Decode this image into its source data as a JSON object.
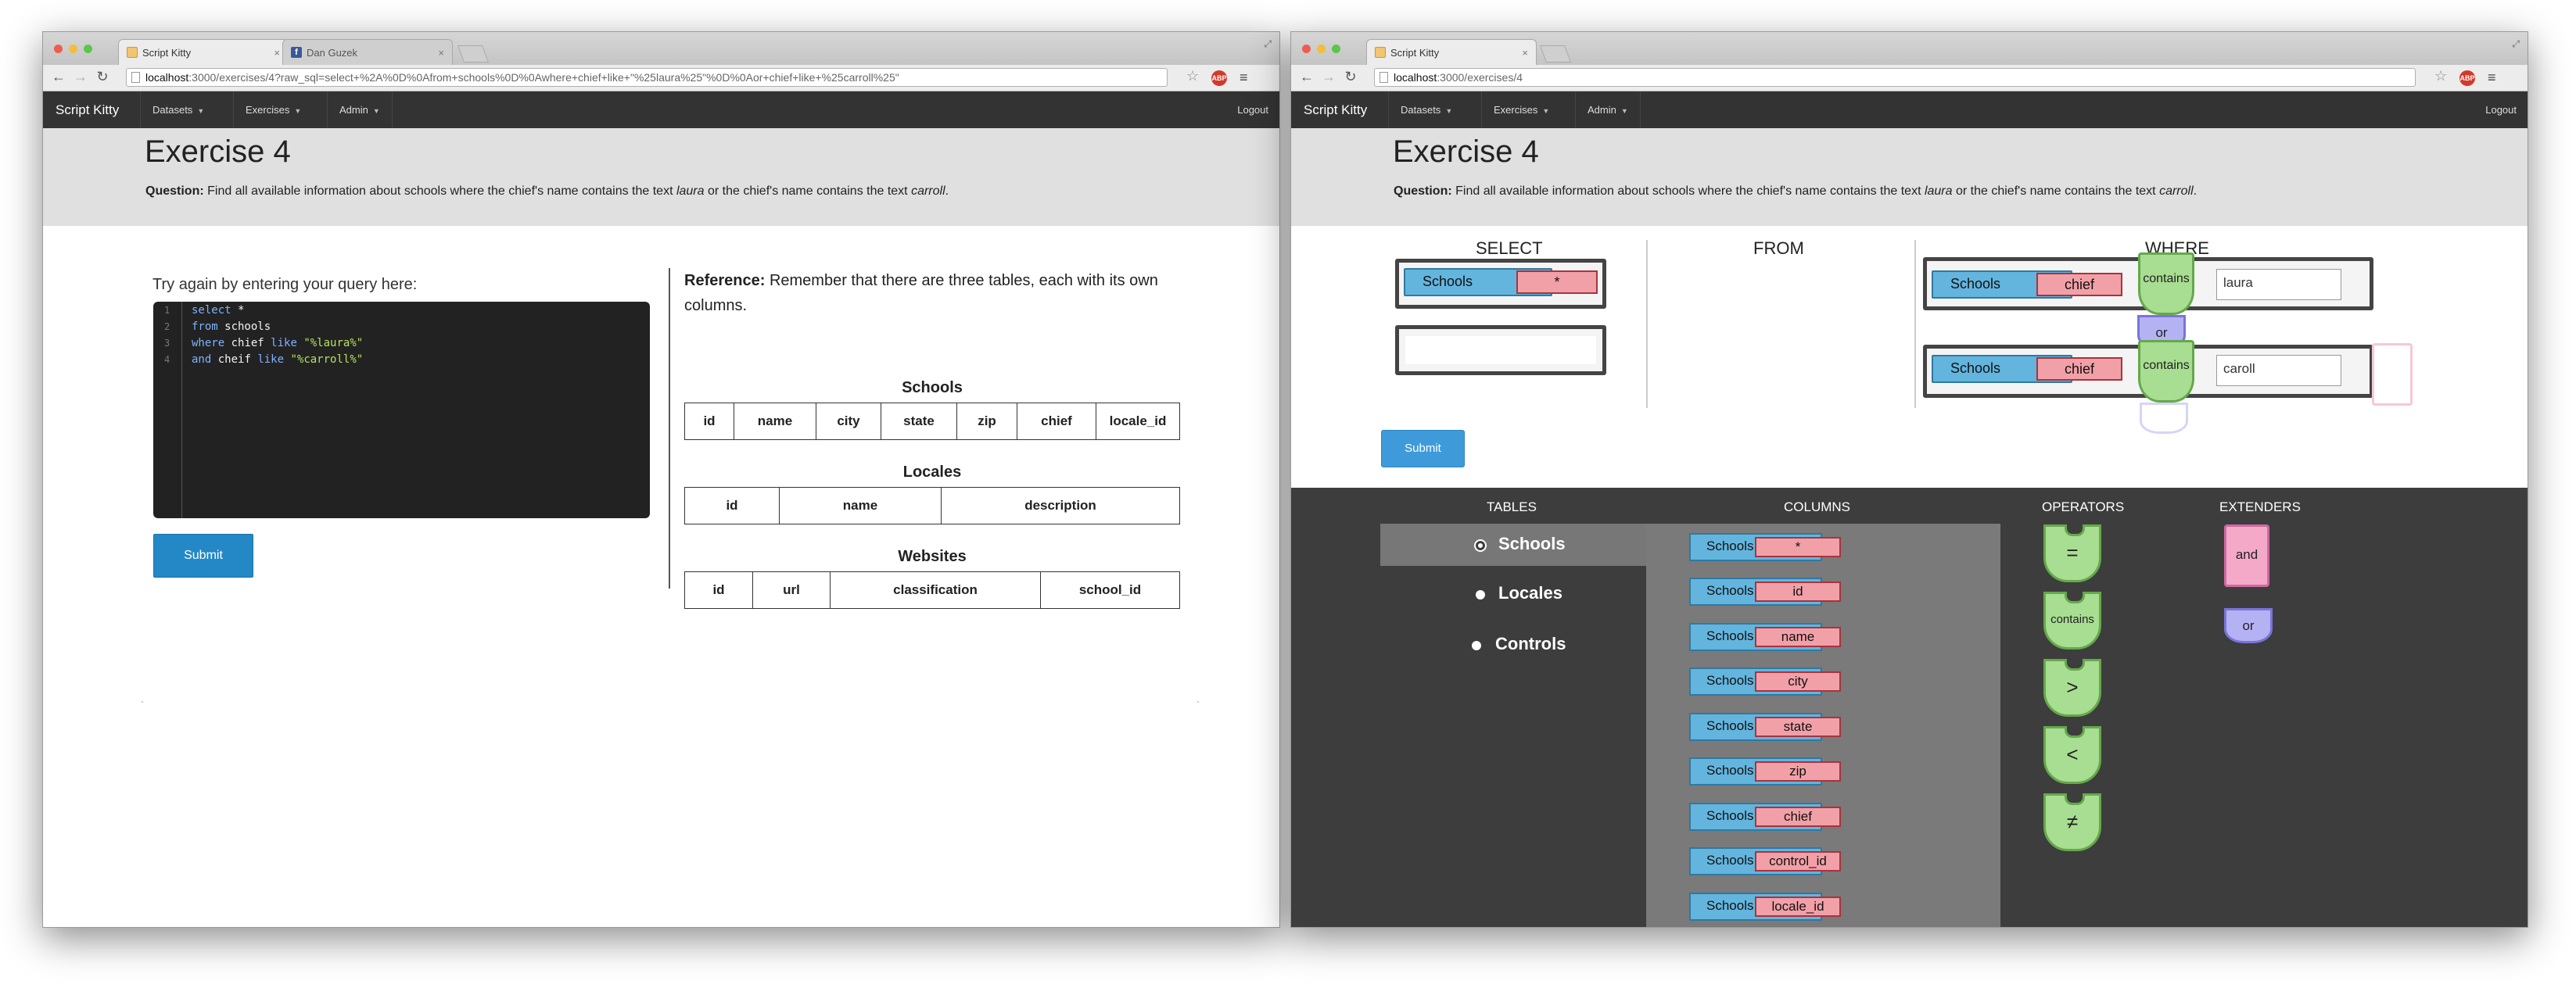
{
  "left": {
    "tabs": [
      {
        "title": "Script Kitty",
        "close": "×"
      },
      {
        "title": "Dan Guzek",
        "close": "×"
      }
    ],
    "url_host": "localhost",
    "url_path": ":3000/exercises/4?raw_sql=select+%2A%0D%0Afrom+schools%0D%0Awhere+chief+like+\"%25laura%25\"%0D%0Aor+chief+like+%25carroll%25\"",
    "nav": {
      "brand": "Script Kitty",
      "datasets": "Datasets",
      "exercises": "Exercises",
      "admin": "Admin",
      "logout": "Logout"
    },
    "title": "Exercise 4",
    "question_label": "Question:",
    "question_pre": " Find all available information about schools where the chief's name contains the text ",
    "question_term1": "laura",
    "question_mid": " or the chief's name contains the text ",
    "question_term2": "carroll",
    "question_end": ".",
    "try_label": "Try again by entering your query here:",
    "code": {
      "line_numbers": [
        "1",
        "2",
        "3",
        "4"
      ],
      "l1_kw": "select",
      "l1_rest": " *",
      "l2_kw": "from",
      "l2_rest": " schools",
      "l3_kw": "where",
      "l3_id": " chief ",
      "l3_kw2": "like",
      "l3_str": " \"%laura%\"",
      "l4_kw": "and",
      "l4_id": " cheif ",
      "l4_kw2": "like",
      "l4_str": " \"%carroll%\""
    },
    "submit": "Submit",
    "reference_label": "Reference:",
    "reference_text": " Remember that there are three tables, each with its own columns.",
    "schools_title": "Schools",
    "schools_cols": [
      "id",
      "name",
      "city",
      "state",
      "zip",
      "chief",
      "locale_id"
    ],
    "locales_title": "Locales",
    "locales_cols": [
      "id",
      "name",
      "description"
    ],
    "websites_title": "Websites",
    "websites_cols": [
      "id",
      "url",
      "classification",
      "school_id"
    ]
  },
  "right": {
    "tab_title": "Script Kitty",
    "tab_close": "×",
    "url_host": "localhost",
    "url_path": ":3000/exercises/4",
    "nav": {
      "brand": "Script Kitty",
      "datasets": "Datasets",
      "exercises": "Exercises",
      "admin": "Admin",
      "logout": "Logout"
    },
    "title": "Exercise 4",
    "question_label": "Question:",
    "question_pre": " Find all available information about schools where the chief's name contains the text ",
    "question_term1": "laura",
    "question_mid": " or the chief's name contains the text ",
    "question_term2": "carroll",
    "question_end": ".",
    "builder": {
      "select_label": "SELECT",
      "from_label": "FROM",
      "where_label": "WHERE",
      "select_table": "Schools",
      "select_col": "*",
      "cond1_table": "Schools",
      "cond1_col": "chief",
      "cond1_op": "contains",
      "cond1_value": "laura",
      "connector": "or",
      "cond2_table": "Schools",
      "cond2_col": "chief",
      "cond2_op": "contains",
      "cond2_value": "caroll"
    },
    "submit": "Submit",
    "palette": {
      "tables_head": "TABLES",
      "columns_head": "COLUMNS",
      "operators_head": "OPERATORS",
      "extenders_head": "EXTENDERS",
      "tables": [
        "Schools",
        "Locales",
        "Controls"
      ],
      "column_table": "Schools",
      "columns": [
        "*",
        "id",
        "name",
        "city",
        "state",
        "zip",
        "chief",
        "control_id",
        "locale_id"
      ],
      "operators": [
        "=",
        "contains",
        ">",
        "<",
        "≠"
      ],
      "extender_and": "and",
      "extender_or": "or"
    }
  }
}
